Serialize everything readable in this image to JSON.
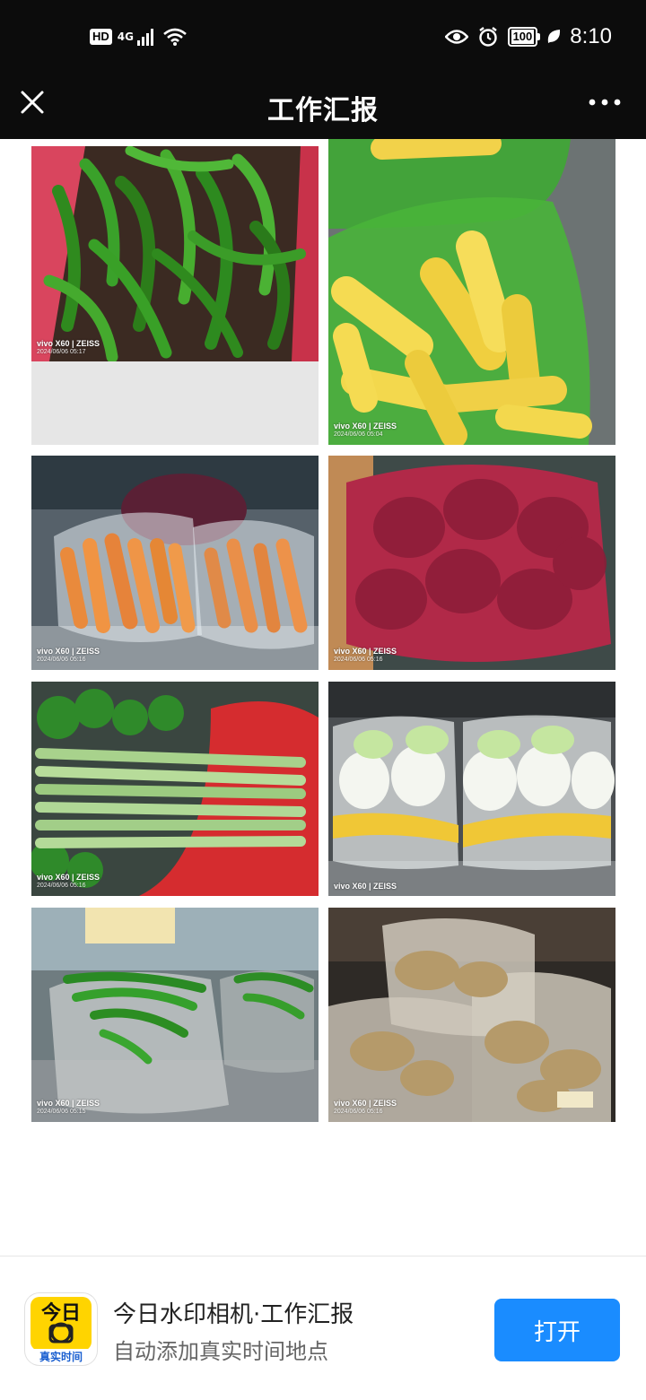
{
  "status_bar": {
    "hd": "HD",
    "network": "4G",
    "battery": "100",
    "time": "8:10"
  },
  "header": {
    "title": "工作汇报"
  },
  "photos": [
    {
      "model": "vivo X60 | ZEISS",
      "time": "2024/06/06 05:17",
      "subject": "green peppers"
    },
    {
      "model": "vivo X60 | ZEISS",
      "time": "2024/06/06 05:04",
      "subject": "corn"
    },
    {
      "model": "vivo X60 | ZEISS",
      "time": "2024/06/06 05:16",
      "subject": "carrots"
    },
    {
      "model": "vivo X60 | ZEISS",
      "time": "2024/06/06 05:16",
      "subject": "red onions"
    },
    {
      "model": "vivo X60 | ZEISS",
      "time": "2024/06/06 05:16",
      "subject": "celery"
    },
    {
      "model": "vivo X60 | ZEISS",
      "time": "",
      "subject": "napa cabbage"
    },
    {
      "model": "vivo X60 | ZEISS",
      "time": "2024/06/06 05:15",
      "subject": "leafy greens"
    },
    {
      "model": "vivo X60 | ZEISS",
      "time": "2024/06/06 05:16",
      "subject": "ginger"
    }
  ],
  "footer": {
    "app_icon_top": "今日",
    "app_icon_bottom": "真实时间",
    "app_name": "今日水印相机·工作汇报",
    "app_desc": "自动添加真实时间地点",
    "open_label": "打开"
  },
  "colors": {
    "bar_bg": "#0c0c0c",
    "accent": "#1a8cff",
    "app_icon_yellow": "#ffd400"
  }
}
